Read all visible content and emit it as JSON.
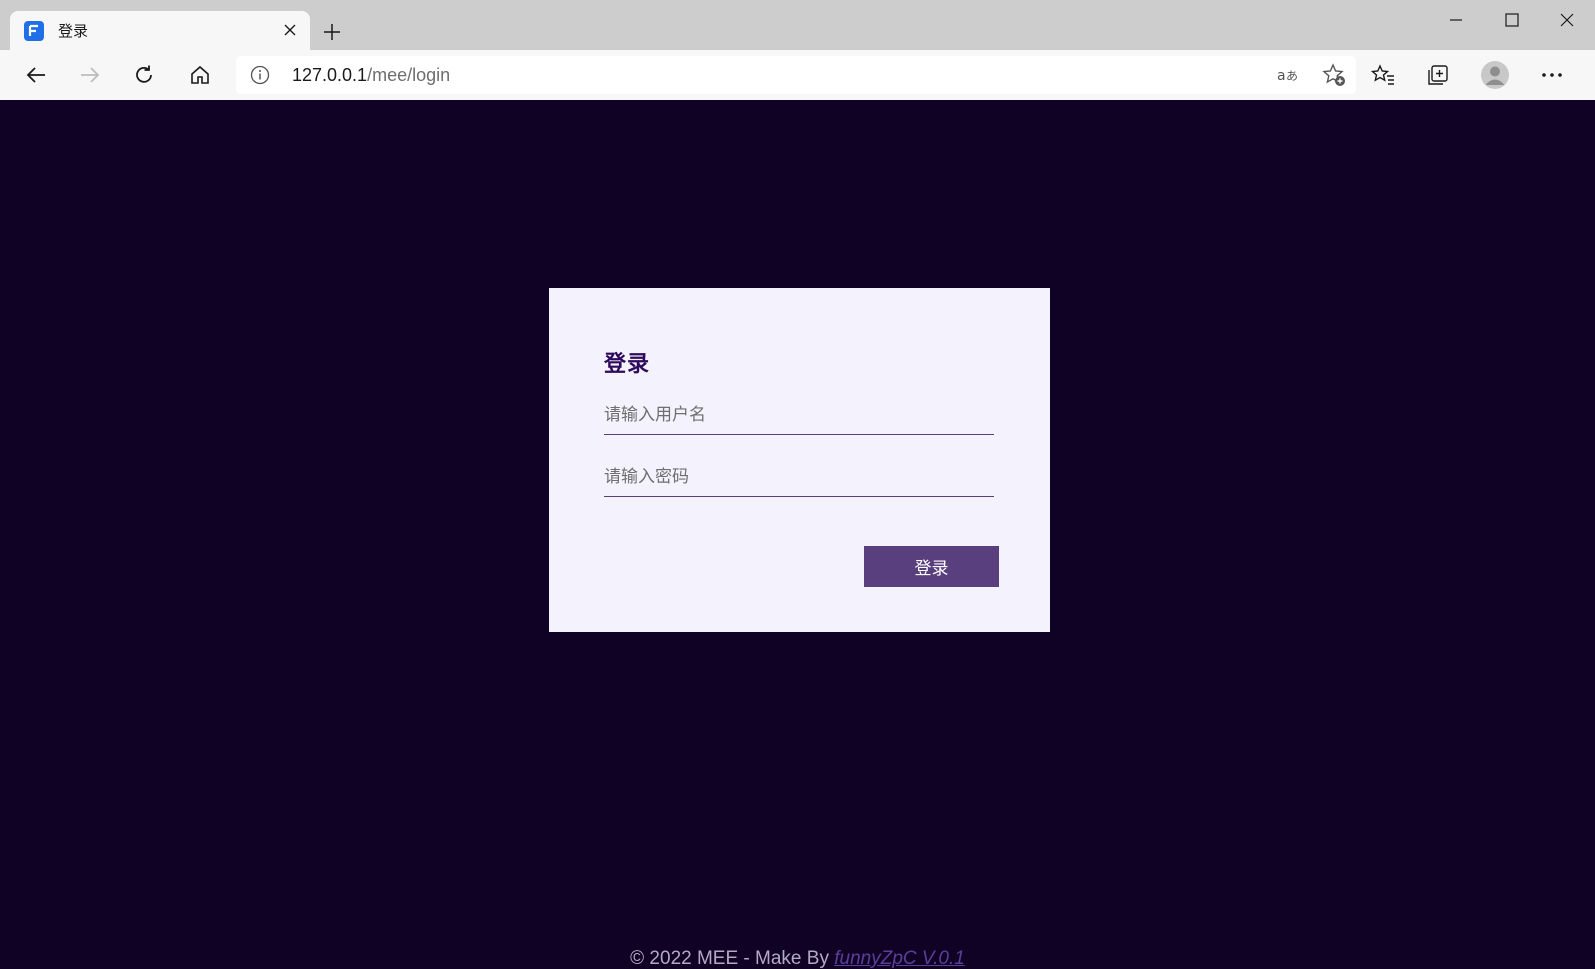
{
  "browser": {
    "tab": {
      "title": "登录",
      "favicon_letter": "F",
      "favicon_color": "#1e6fe8"
    },
    "window_controls": {
      "minimize": "minimize-icon",
      "maximize": "maximize-icon",
      "close": "close-icon"
    },
    "toolbar": {
      "url_host": "127.0.0.1",
      "url_path": "/mee/login"
    }
  },
  "login": {
    "title": "登录",
    "username_placeholder": "请输入用户名",
    "password_placeholder": "请输入密码",
    "submit_label": "登录"
  },
  "footer": {
    "text": "© 2022 MEE - Make By ",
    "link_text": "funnyZpC V.0.1"
  },
  "colors": {
    "page_background": "#100224",
    "card_background": "#f3f2fd",
    "accent": "#5a3f7e",
    "title_color": "#2e0a5c"
  }
}
